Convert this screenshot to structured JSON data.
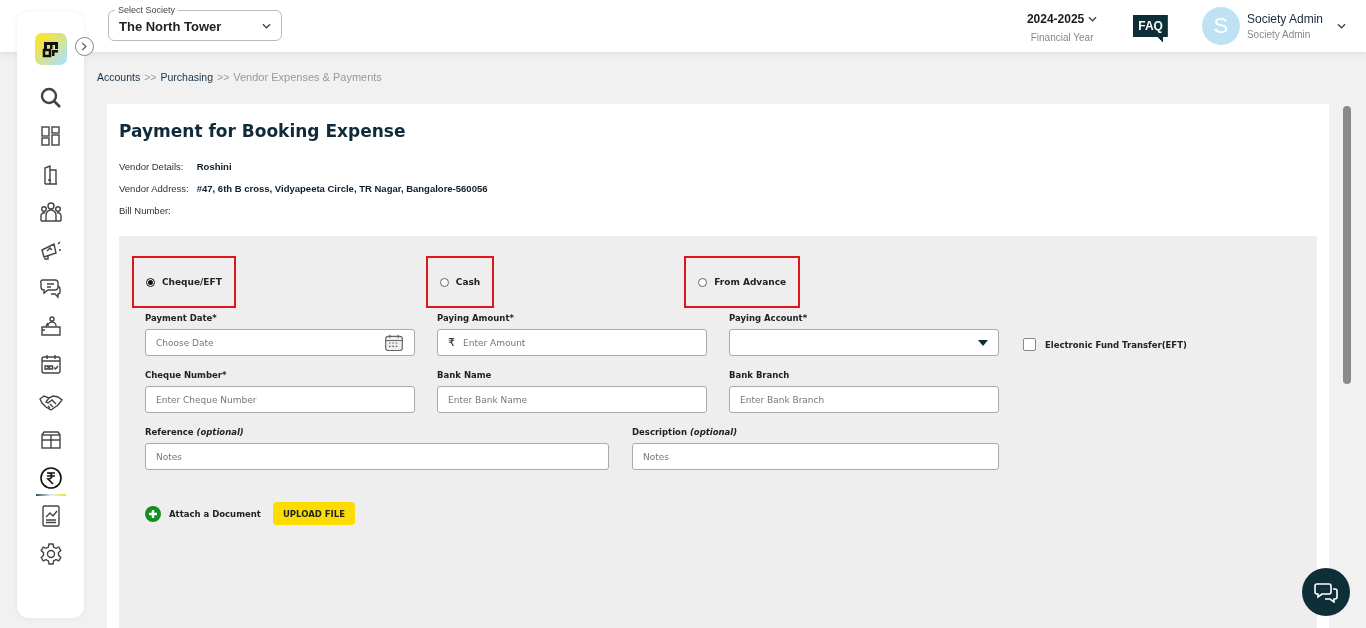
{
  "header": {
    "society_select": {
      "label": "Select Society",
      "value": "The North Tower"
    },
    "year": {
      "value": "2024-2025",
      "caption": "Financial Year"
    },
    "faq": "FAQ",
    "user": {
      "initial": "S",
      "name": "Society Admin",
      "role": "Society Admin"
    }
  },
  "sidebar": {
    "items": [
      {
        "selected": false
      },
      {
        "selected": false
      },
      {
        "selected": false
      },
      {
        "selected": false
      },
      {
        "selected": false
      },
      {
        "selected": false
      },
      {
        "selected": false
      },
      {
        "selected": false
      },
      {
        "selected": false
      },
      {
        "selected": false
      },
      {
        "selected": true
      },
      {
        "selected": false
      },
      {
        "selected": false
      }
    ]
  },
  "breadcrumb": [
    {
      "label": "Accounts",
      "current": false
    },
    {
      "separator": ">>",
      "label": "Purchasing",
      "current": false
    },
    {
      "separator": ">>",
      "label": "Vendor Expenses & Payments",
      "current": true
    }
  ],
  "page": {
    "title": "Payment for Booking Expense",
    "details": [
      {
        "label": "Vendor Details:",
        "value": "Roshini"
      },
      {
        "label": "Vendor Address:",
        "value": "#47, 6th B cross, Vidyapeeta Circle, TR Nagar, Bangalore-560056"
      },
      {
        "label": "Bill Number:"
      }
    ],
    "payment_modes": [
      {
        "label": "Cheque/EFT",
        "selected": true,
        "highlighted": true
      },
      {
        "label": "Cash",
        "selected": false,
        "highlighted": true
      },
      {
        "label": "From Advance",
        "selected": false,
        "highlighted": true
      }
    ],
    "fields": [
      {
        "kind": "date",
        "label": "Payment Date*",
        "placeholder": "Choose Date"
      },
      {
        "kind": "amount",
        "label": "Paying Amount*",
        "currency": "₹",
        "placeholder": "Enter Amount"
      },
      {
        "kind": "select",
        "label": "Paying Account*"
      },
      {
        "kind": "checkbox",
        "label": "Electronic Fund Transfer(EFT)",
        "checked": false
      },
      {
        "kind": "text",
        "label": "Cheque Number*",
        "placeholder": "Enter Cheque Number"
      },
      {
        "kind": "text",
        "label": "Bank Name",
        "placeholder": "Enter Bank Name"
      },
      {
        "kind": "text",
        "label": "Bank Branch",
        "placeholder": "Enter Bank Branch"
      },
      {
        "kind": "wide",
        "label": "Reference *(optional)*",
        "placeholder": "Notes"
      },
      {
        "kind": "notes",
        "label": "Description *(optional)*",
        "placeholder": "Notes"
      }
    ],
    "attach": {
      "label": "Attach a Document",
      "button": "UPLOAD FILE"
    }
  }
}
